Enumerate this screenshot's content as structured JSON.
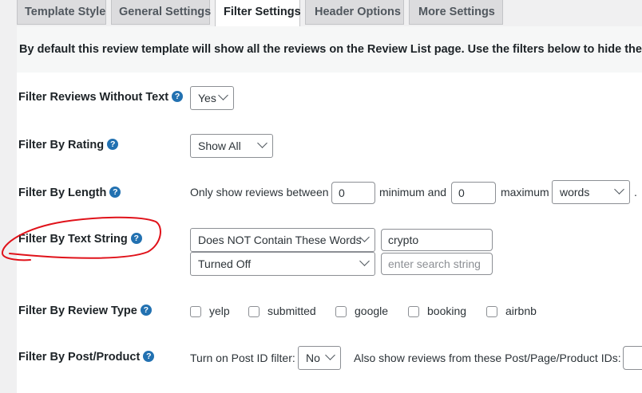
{
  "tabs": [
    "Template Style",
    "General Settings",
    "Filter Settings",
    "Header Options",
    "More Settings"
  ],
  "intro": "By default this review template will show all the reviews on the Review List page. Use the filters below to hide the ones you",
  "help_glyph": "?",
  "rows": {
    "without_text": {
      "label": "Filter Reviews Without Text",
      "value": "Yes"
    },
    "rating": {
      "label": "Filter By Rating",
      "value": "Show All"
    },
    "length": {
      "label": "Filter By Length",
      "prefix": "Only show reviews between",
      "min": "0",
      "min_label": "minimum and",
      "max": "0",
      "max_label": "maximum",
      "unit": "words",
      "suffix": "."
    },
    "text_string": {
      "label": "Filter By Text String",
      "mode1": "Does NOT Contain These Words",
      "value1": "crypto",
      "mode2": "Turned Off",
      "placeholder2": "enter search string"
    },
    "review_type": {
      "label": "Filter By Review Type",
      "options": [
        "yelp",
        "submitted",
        "google",
        "booking",
        "airbnb"
      ]
    },
    "post_product": {
      "label": "Filter By Post/Product",
      "toggle_label": "Turn on Post ID filter:",
      "toggle_value": "No",
      "ids_label": "Also show reviews from these Post/Page/Product IDs:"
    }
  },
  "annotation_color": "#e0121a"
}
